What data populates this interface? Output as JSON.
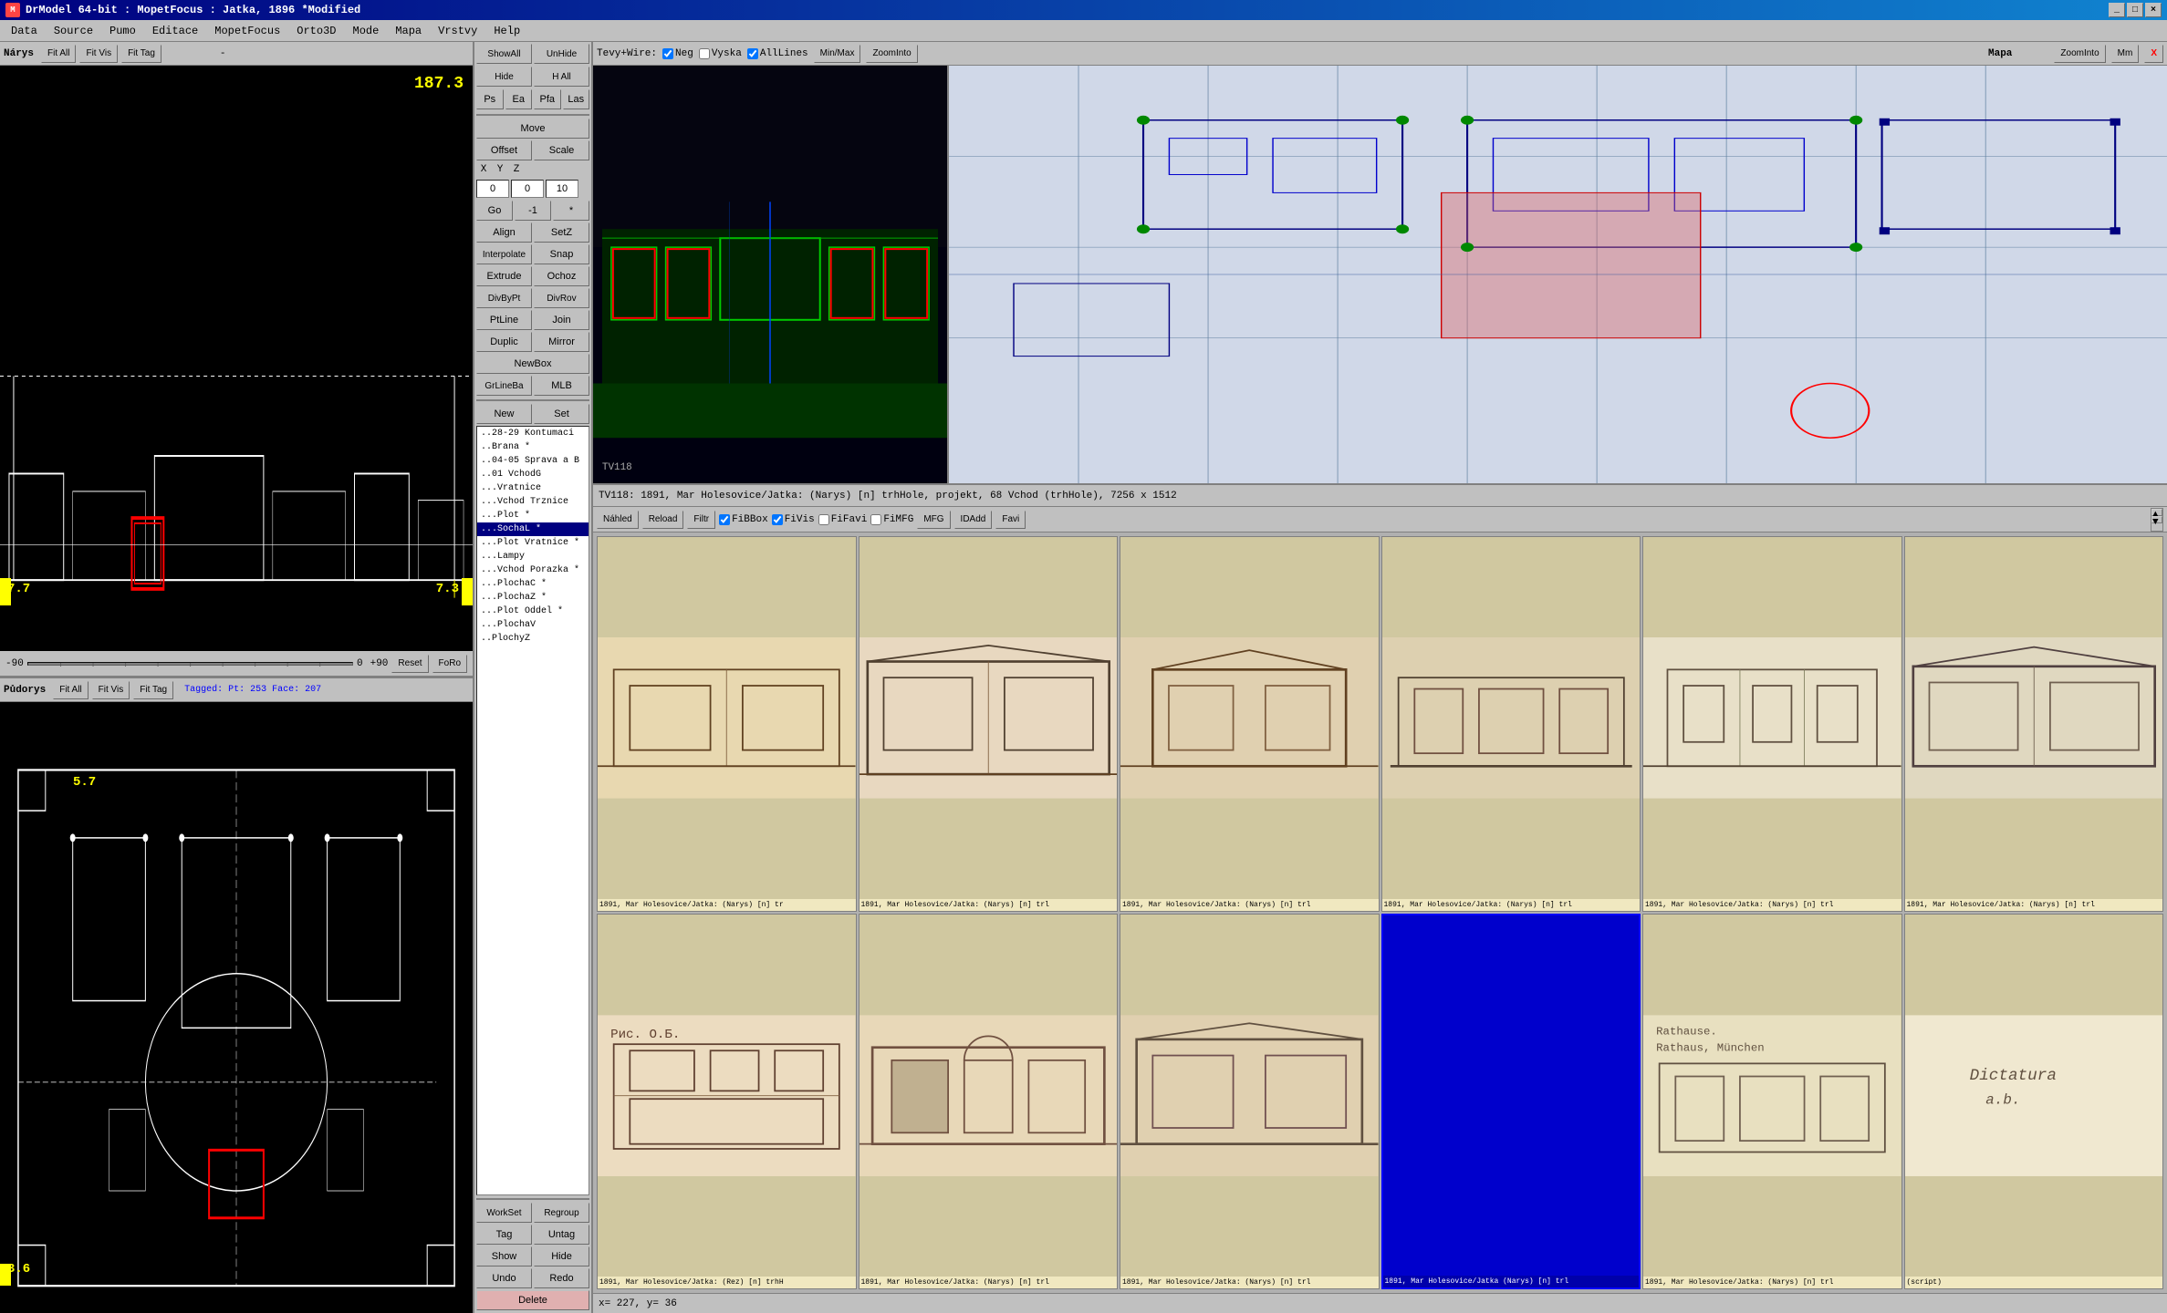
{
  "titleBar": {
    "icon": "M",
    "title": "DrModel 64-bit : MopetFocus : Jatka, 1896 *Modified",
    "controls": [
      "_",
      "□",
      "×"
    ]
  },
  "menuBar": {
    "items": [
      "Data",
      "Source",
      "Pumo",
      "Editace",
      "MopetFocus",
      "Orto3D",
      "Mode",
      "Mapa",
      "Vrstvy",
      "Help"
    ]
  },
  "topShowBar": {
    "showAll": "ShowAll",
    "unHide": "UnHide",
    "hide": "Hide",
    "hAll": "H All"
  },
  "tabButtons": {
    "ps": "Ps",
    "ea": "Ea",
    "pfa": "Pfa",
    "las": "Las"
  },
  "narysViewport": {
    "label": "Nárys",
    "fitAll": "Fit All",
    "fitVis": "Fit Vis",
    "fitTag": "Fit Tag",
    "dash": "-",
    "measurement": "187.3",
    "leftMeasure": "7.7",
    "rightMeasure": "7.3"
  },
  "sliderBar": {
    "negValue": "-90",
    "posValue": "+90",
    "centerValue": "0",
    "reset": "Reset",
    "foRo": "FoRo"
  },
  "pudorysViewport": {
    "label": "Půdorys",
    "fitAll": "Fit All",
    "fitVis": "Fit Vis",
    "fitTag": "Fit Tag",
    "taggedInfo": "Tagged: Pt: 253  Face: 207",
    "measurement": "5.7",
    "leftMeasure": "3.6"
  },
  "toolPanel": {
    "move": "Move",
    "offset": "Offset",
    "scale": "Scale",
    "xLabel": "X",
    "yLabel": "Y",
    "zLabel": "Z",
    "xValue": "0",
    "yValue": "0",
    "zValue": "10",
    "go": "Go",
    "goValue": "-1",
    "goStar": "*",
    "align": "Align",
    "setZ": "SetZ",
    "interpolate": "Interpolate",
    "snap": "Snap",
    "extrude": "Extrude",
    "ochoz": "Ochoz",
    "divByPt": "DivByPt",
    "divRov": "DivRov",
    "ptLine": "PtLine",
    "join": "Join",
    "duplic": "Duplic",
    "mirror": "Mirror",
    "newBox": "NewBox",
    "grLineBa": "GrLineBa",
    "mlb": "MLB",
    "new": "New",
    "set": "Set",
    "workSet": "WorkSet",
    "regroup": "Regroup",
    "tag": "Tag",
    "untag": "Untag",
    "show": "Show",
    "hide": "Hide",
    "undo": "Undo",
    "redo": "Redo",
    "delete": "Delete"
  },
  "layers": [
    "..28-29 Kontumaci",
    "..Brana *",
    "..04-05 Sprava a B",
    "..01 VchodG",
    "...Vratnice",
    "...Vchod Trznice",
    "...Plot *",
    "...SochaL *",
    "...Plot Vratnice *",
    "...Lampy",
    "...Vchod Porazka *",
    "...PlochaC *",
    "...PlochaZ *",
    "...Plot Oddel *",
    "...PlochaV",
    "..PlochyZ"
  ],
  "selectedLayer": "...SochaL *",
  "tevyWire": {
    "label": "Tevy+Wire:",
    "neg": "Neg",
    "vyska": "Vyska",
    "allLines": "AllLines",
    "minMax": "Min/Max",
    "zoomInto": "ZoomInto",
    "mapa": "Mapa",
    "zoomInto2": "ZoomInto",
    "mm": "Mm",
    "close": "X"
  },
  "tevyWireChecks": {
    "neg": true,
    "vyska": false,
    "allLines": true
  },
  "view3dLabel": "TV118",
  "infoBar": {
    "text": "TV118: 1891, Mar Holesovice/Jatka: (Narys) [n] trhHole, projekt, 68 Vchod (trhHole), 7256 x 1512"
  },
  "photoToolbar": {
    "nahled": "Náhled",
    "reload": "Reload",
    "filtr": "Filtr",
    "fiBBox": "FiBBox",
    "fiVis": "FiVis",
    "fiFavi": "FiFavi",
    "fiMFG": "FiMFG",
    "mfg": "MFG",
    "idAdd": "IDAdd",
    "favi": "Favi",
    "fiBBoxCheck": true,
    "fiVisCheck": true,
    "fiFaviCheck": false,
    "fiMFGCheck": false
  },
  "photos": [
    {
      "caption": "1891, Mar Holesovice/Jatka: (Narys) [n] tr",
      "selected": false
    },
    {
      "caption": "1891, Mar Holesovice/Jatka: (Narys) [n] trl",
      "selected": false
    },
    {
      "caption": "1891, Mar Holesovice/Jatka: (Narys) [n] trl",
      "selected": false
    },
    {
      "caption": "1891, Mar Holesovice/Jatka: (Narys) [n] trl",
      "selected": false
    },
    {
      "caption": "1891, Mar Holesovice/Jatka: (Narys) [n] trl",
      "selected": false
    },
    {
      "caption": "1891, Mar Holesovice/Jatka: (Narys) [n] trl",
      "selected": false
    },
    {
      "caption": "1891, Mar Holesovice/Jatka: (Rez) [n] trhH",
      "selected": false
    },
    {
      "caption": "1891, Mar Holesovice/Jatka: (Narys) [n] trl",
      "selected": false
    },
    {
      "caption": "1891, Mar Holesovice/Jatka: (Narys) [n] trl",
      "selected": false
    },
    {
      "caption": "1891, Mar Holesovice/Jatka (Narys) [n] trl",
      "selected": true,
      "blue": true
    },
    {
      "caption": "1891, Mar Holesovice/Jatka: (Narys) [n] trl",
      "selected": false
    },
    {
      "caption": "(script)",
      "selected": false
    }
  ],
  "statusBar": {
    "coords": "x= 227, y= 36"
  }
}
